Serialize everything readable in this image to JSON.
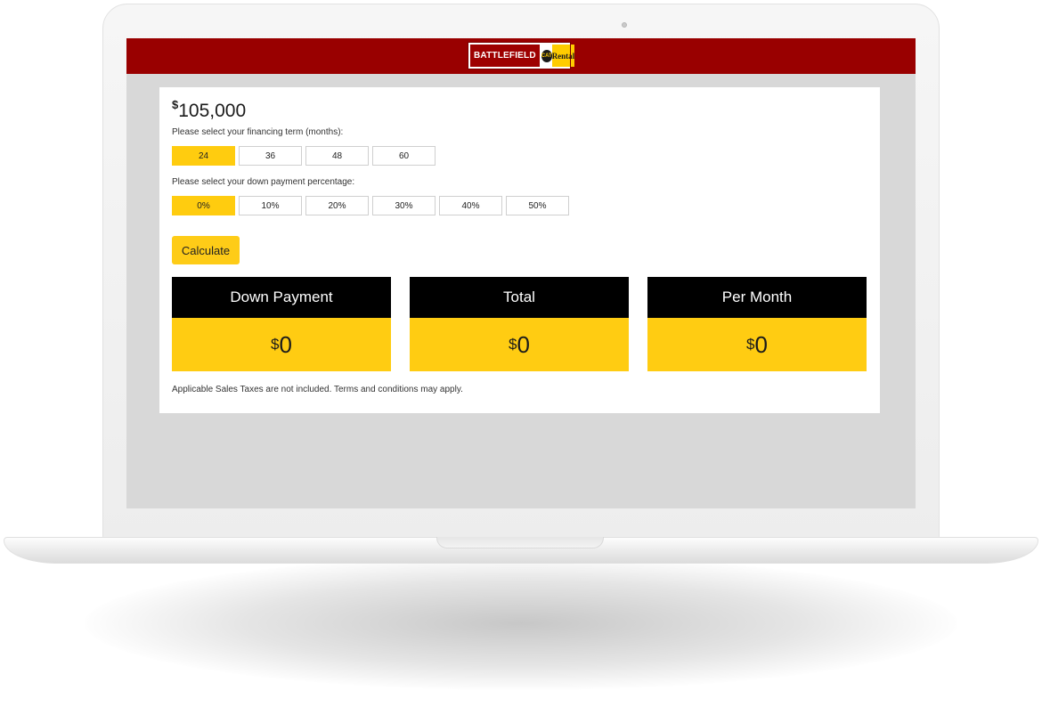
{
  "header": {
    "logo": {
      "brand": "BATTLEFIELD",
      "badge": "CAT",
      "suffix": "Rental"
    }
  },
  "calculator": {
    "price": {
      "currency_symbol": "$",
      "amount": "105,000"
    },
    "term_prompt": "Please select your financing term (months):",
    "term_options": [
      "24",
      "36",
      "48",
      "60"
    ],
    "term_selected": "24",
    "down_prompt": "Please select your down payment percentage:",
    "down_options": [
      "0%",
      "10%",
      "20%",
      "30%",
      "40%",
      "50%"
    ],
    "down_selected": "0%",
    "calculate_label": "Calculate",
    "results": [
      {
        "label": "Down Payment",
        "currency_symbol": "$",
        "value": "0"
      },
      {
        "label": "Total",
        "currency_symbol": "$",
        "value": "0"
      },
      {
        "label": "Per Month",
        "currency_symbol": "$",
        "value": "0"
      }
    ],
    "disclaimer": "Applicable Sales Taxes are not included. Terms and conditions may apply."
  },
  "colors": {
    "header_bg": "#990000",
    "accent_yellow": "#ffcc12",
    "result_header_bg": "#000000",
    "screen_bg": "#d8d8d8"
  }
}
